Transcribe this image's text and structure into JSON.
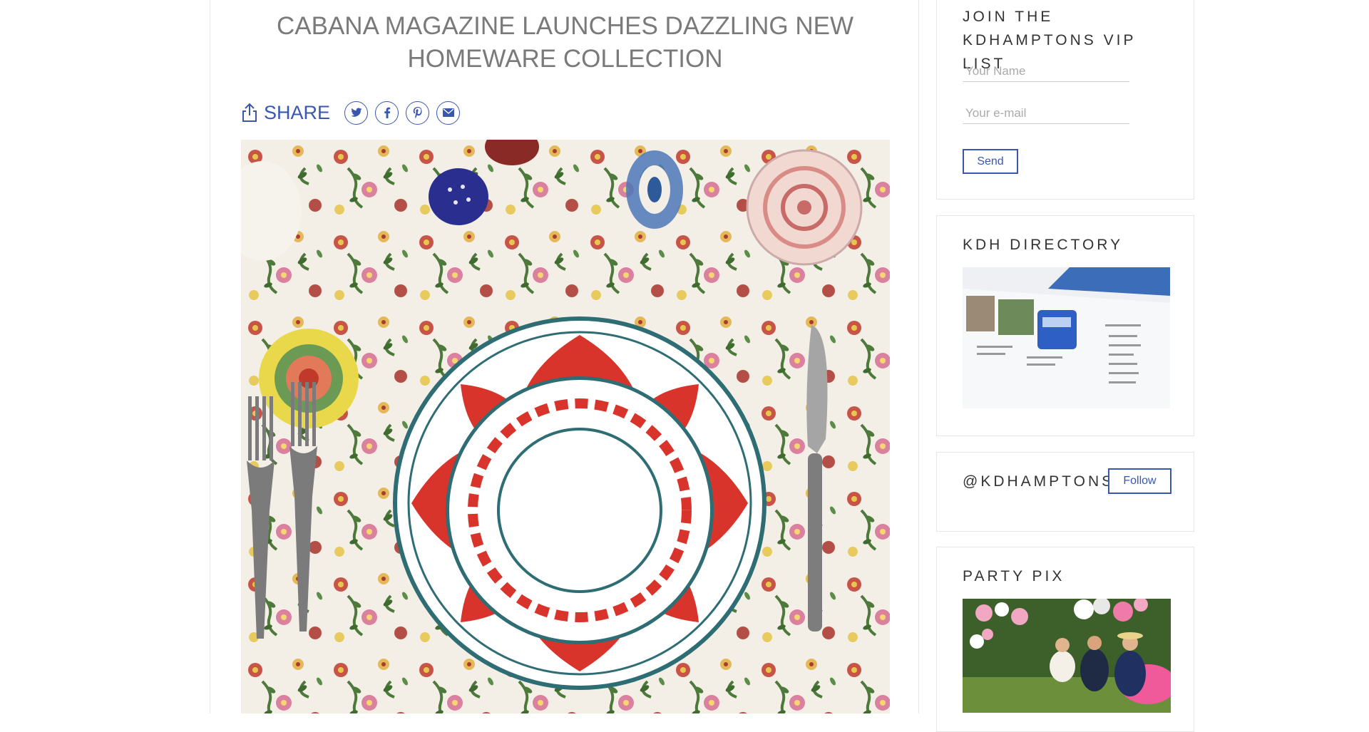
{
  "article": {
    "title": "CABANA MAGAZINE LAUNCHES DAZZLING NEW HOMEWARE COLLECTION",
    "share_label": "SHARE",
    "social": [
      {
        "name": "twitter-icon"
      },
      {
        "name": "facebook-icon"
      },
      {
        "name": "pinterest-icon"
      },
      {
        "name": "email-icon"
      }
    ]
  },
  "sidebar": {
    "vip": {
      "heading": "JOIN THE KDHAMPTONS VIP LIST",
      "name_placeholder": "Your Name",
      "email_placeholder": "Your e-mail",
      "send_label": "Send"
    },
    "directory": {
      "heading": "KDH DIRECTORY"
    },
    "instagram": {
      "heading": "@KDHAMPTONS",
      "follow_label": "Follow"
    },
    "party": {
      "heading": "PARTY PIX"
    }
  },
  "colors": {
    "accent": "#3a57b0",
    "title": "#7a7a7a",
    "border": "#e6e6e6"
  }
}
